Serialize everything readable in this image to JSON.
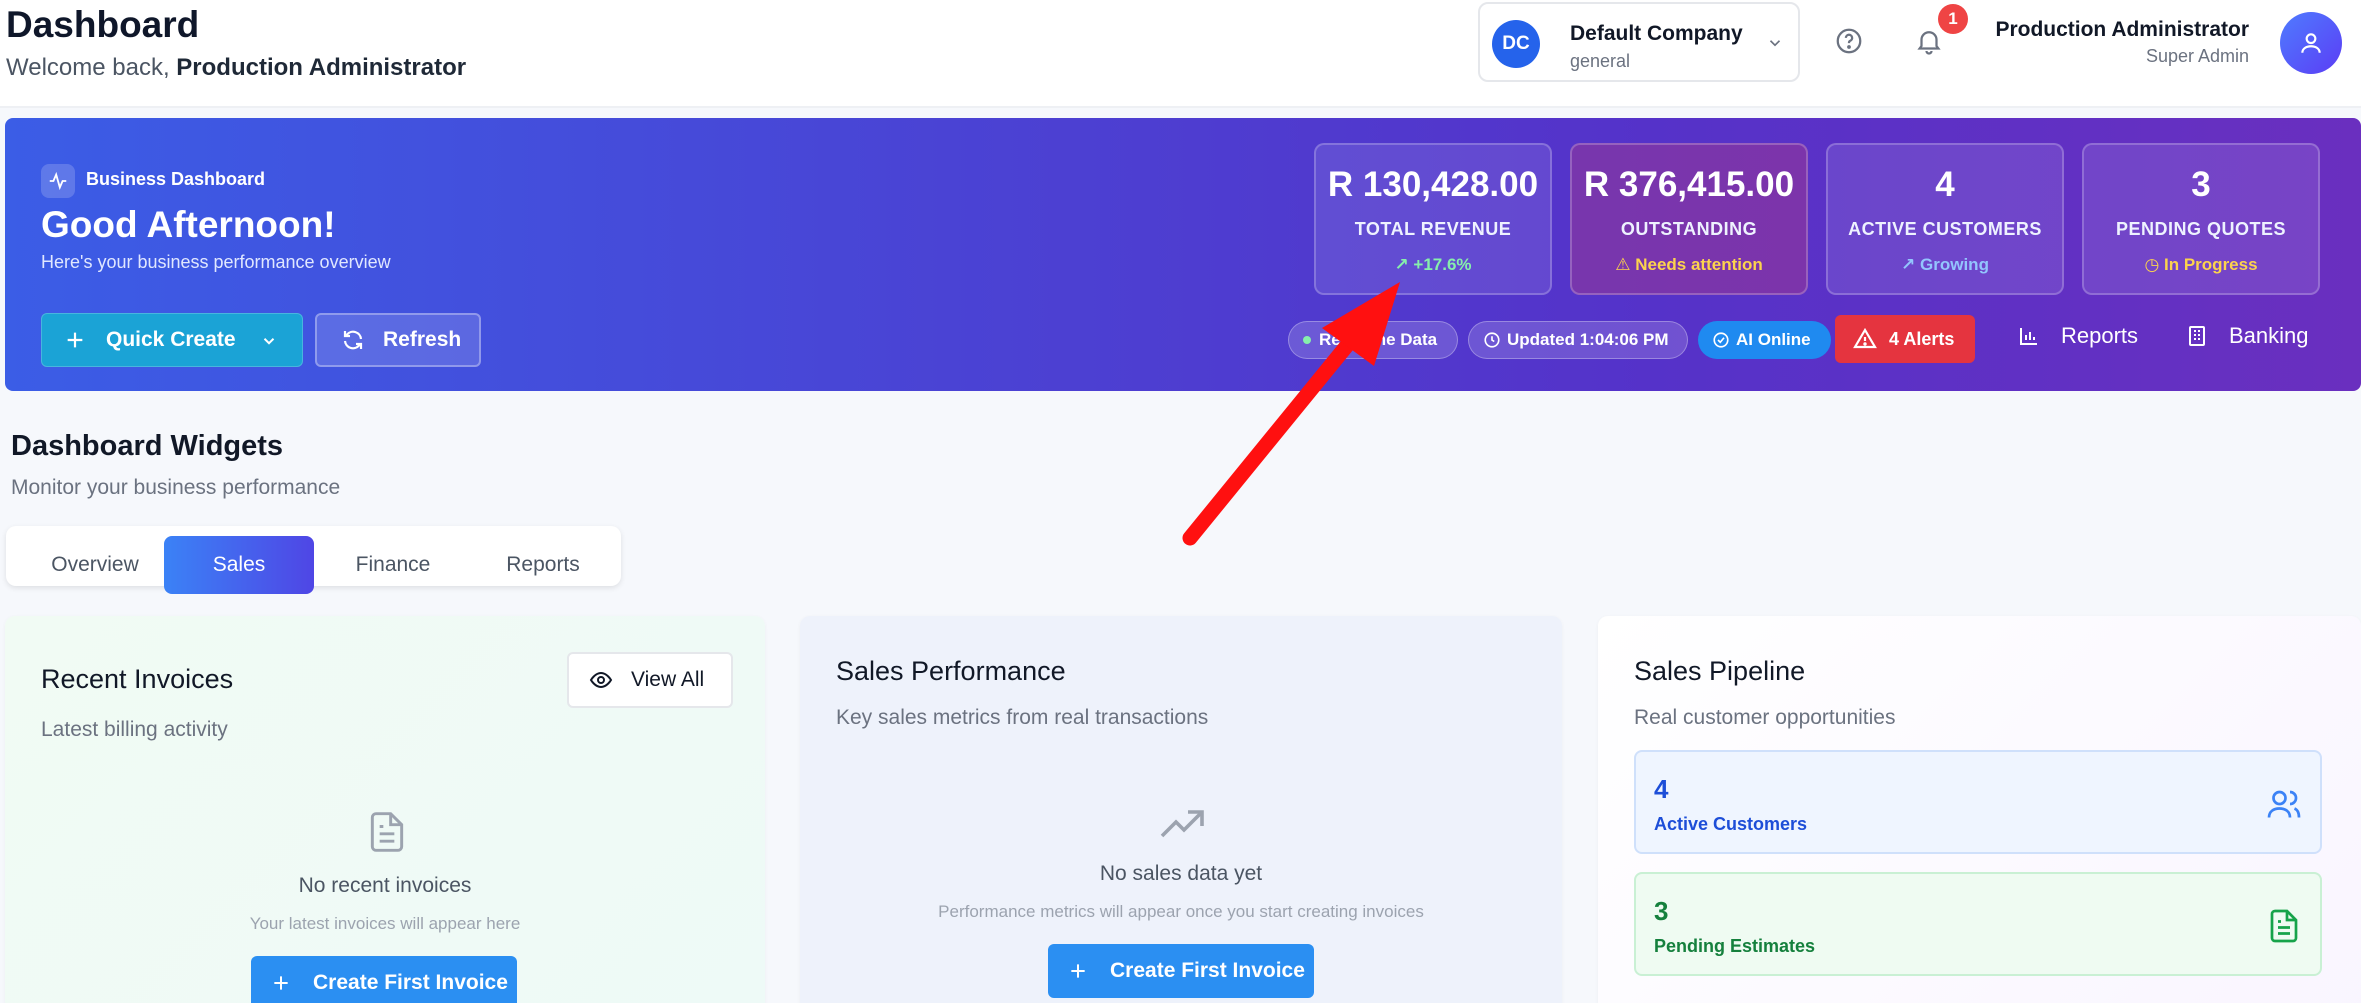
{
  "header": {
    "title": "Dashboard",
    "welcome_prefix": "Welcome back,",
    "welcome_name": "Production Administrator",
    "company": {
      "initials": "DC",
      "name": "Default Company",
      "sub": "general"
    },
    "notifications_count": "1",
    "user": {
      "name": "Production Administrator",
      "role": "Super Admin"
    }
  },
  "hero": {
    "chip_label": "Business Dashboard",
    "greeting": "Good Afternoon!",
    "subtitle": "Here's your business performance overview",
    "quick_create": "Quick Create",
    "refresh": "Refresh",
    "stats": {
      "revenue": {
        "value": "R 130,428.00",
        "label": "TOTAL REVENUE",
        "sub": "+17.6%"
      },
      "outstanding": {
        "value": "R 376,415.00",
        "label": "OUTSTANDING",
        "sub": "Needs attention"
      },
      "customers": {
        "value": "4",
        "label": "ACTIVE CUSTOMERS",
        "sub": "Growing"
      },
      "quotes": {
        "value": "3",
        "label": "PENDING QUOTES",
        "sub": "In Progress"
      }
    },
    "pills": {
      "realtime": "Real-time Data",
      "updated": "Updated 1:04:06 PM",
      "ai": "AI Online"
    },
    "alerts": "4 Alerts",
    "nav": {
      "reports": "Reports",
      "banking": "Banking"
    }
  },
  "widgets": {
    "title": "Dashboard Widgets",
    "subtitle": "Monitor your business performance",
    "tabs": [
      "Overview",
      "Sales",
      "Finance",
      "Reports"
    ],
    "active_tab": "Sales",
    "invoices": {
      "title": "Recent Invoices",
      "subtitle": "Latest billing activity",
      "view_all": "View All",
      "empty_title": "No recent invoices",
      "empty_sub": "Your latest invoices will appear here",
      "cta": "Create First Invoice"
    },
    "sales": {
      "title": "Sales Performance",
      "subtitle": "Key sales metrics from real transactions",
      "empty_title": "No sales data yet",
      "empty_sub": "Performance metrics will appear once you start creating invoices",
      "cta": "Create First Invoice"
    },
    "pipeline": {
      "title": "Sales Pipeline",
      "subtitle": "Real customer opportunities",
      "items": [
        {
          "value": "4",
          "label": "Active Customers"
        },
        {
          "value": "3",
          "label": "Pending Estimates"
        }
      ]
    }
  },
  "colors": {
    "accent": "#2b8ff2",
    "hero_start": "#3b5de6",
    "hero_end": "#6a2fbf",
    "alert": "#e5343f",
    "annotation_arrow": "#ff1010"
  }
}
